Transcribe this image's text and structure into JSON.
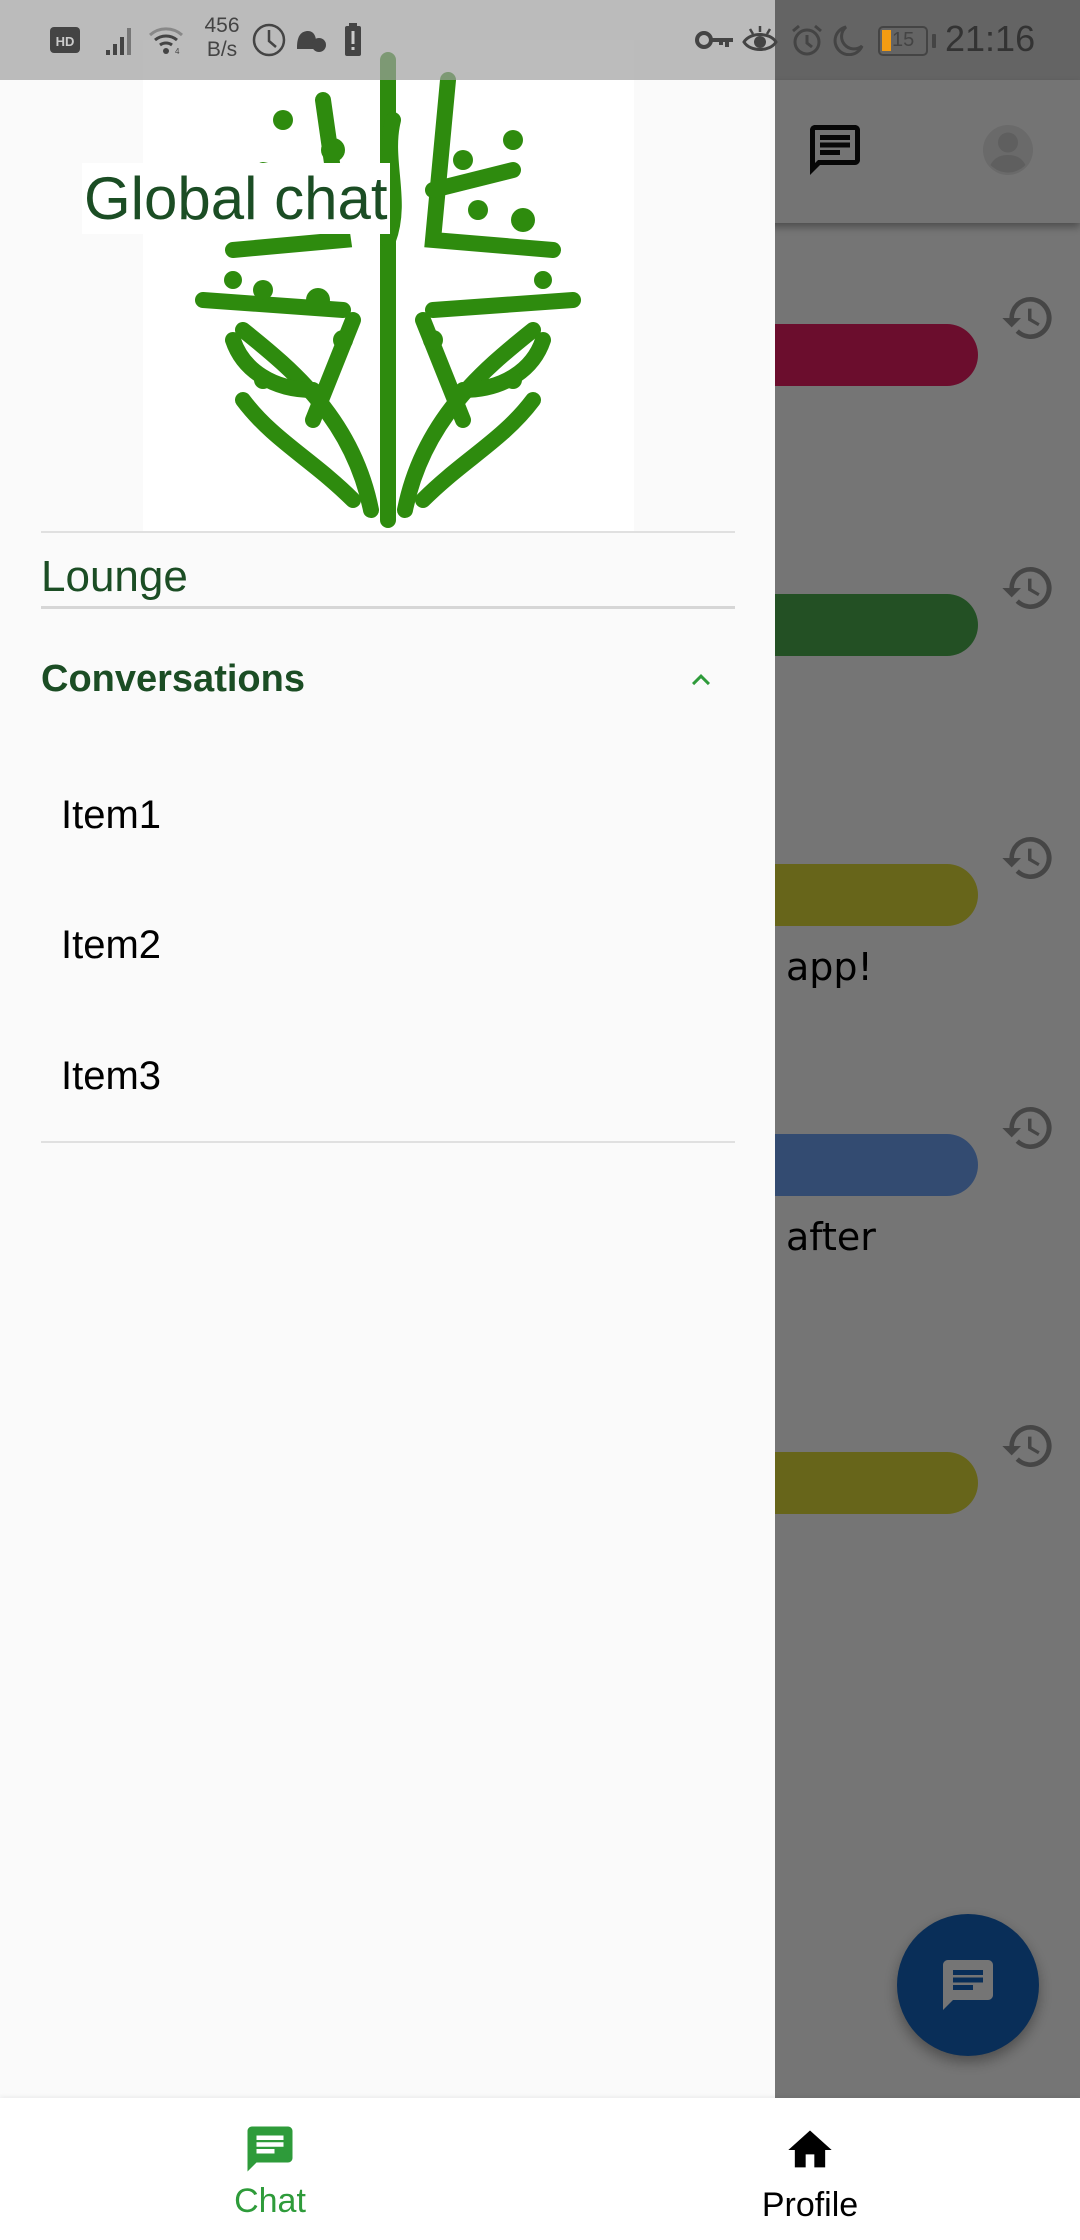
{
  "status_bar": {
    "network_speed_value": "456",
    "network_speed_unit": "B/s",
    "battery_level": "15",
    "time": "21:16",
    "icons": [
      "hd-icon",
      "signal-icon",
      "wifi-icon",
      "clock-icon",
      "incognito-icon",
      "battery-alert-icon",
      "key-icon",
      "eye-icon",
      "alarm-icon",
      "moon-icon",
      "battery-icon"
    ]
  },
  "drawer": {
    "title": "Global chat",
    "logo": "tree-of-people-logo",
    "lounge_label": "Lounge",
    "conversations": {
      "label": "Conversations",
      "expanded": true,
      "items": [
        {
          "label": "Item1"
        },
        {
          "label": "Item2"
        },
        {
          "label": "Item3"
        }
      ]
    }
  },
  "background_app": {
    "header_icons": [
      "chat-icon",
      "avatar-icon"
    ],
    "messages": [
      {
        "bubble_color": "#e91e63",
        "visible_text": ""
      },
      {
        "bubble_color": "#4caf50",
        "visible_text": ""
      },
      {
        "bubble_color": "#e0dc3a",
        "visible_text": "app!"
      },
      {
        "bubble_color": "#6fa3f7",
        "visible_text": "after"
      },
      {
        "bubble_color": "#e0dc3a",
        "visible_text": ""
      }
    ],
    "fab_icon": "chat-icon",
    "fab_color": "#1565c0"
  },
  "bottom_nav": {
    "items": [
      {
        "label": "Chat",
        "icon": "chat-icon",
        "active": true
      },
      {
        "label": "Profile",
        "icon": "home-icon",
        "active": false
      }
    ],
    "active_color": "#2e9b3a"
  }
}
